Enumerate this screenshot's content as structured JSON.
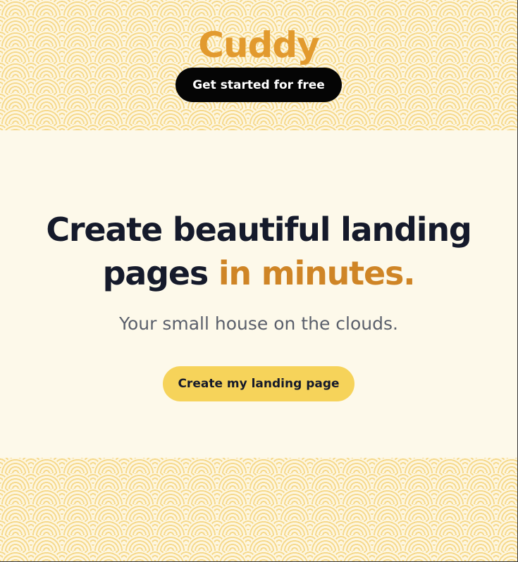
{
  "header": {
    "brand": "Cuddy",
    "cta_label": "Get started for free"
  },
  "hero": {
    "headline_line1": "Create beautiful landing",
    "headline_line2_plain": "pages ",
    "headline_line2_accent": "in minutes.",
    "subtitle": "Your small house on the clouds.",
    "cta_label": "Create my landing page"
  },
  "colors": {
    "brand": "#e29a2e",
    "accent": "#cf8526",
    "headline": "#151a2b",
    "background": "#fdf9ea",
    "pattern": "#f6d98c",
    "primary_button": "#f6d35a",
    "dark_button": "#050505"
  }
}
